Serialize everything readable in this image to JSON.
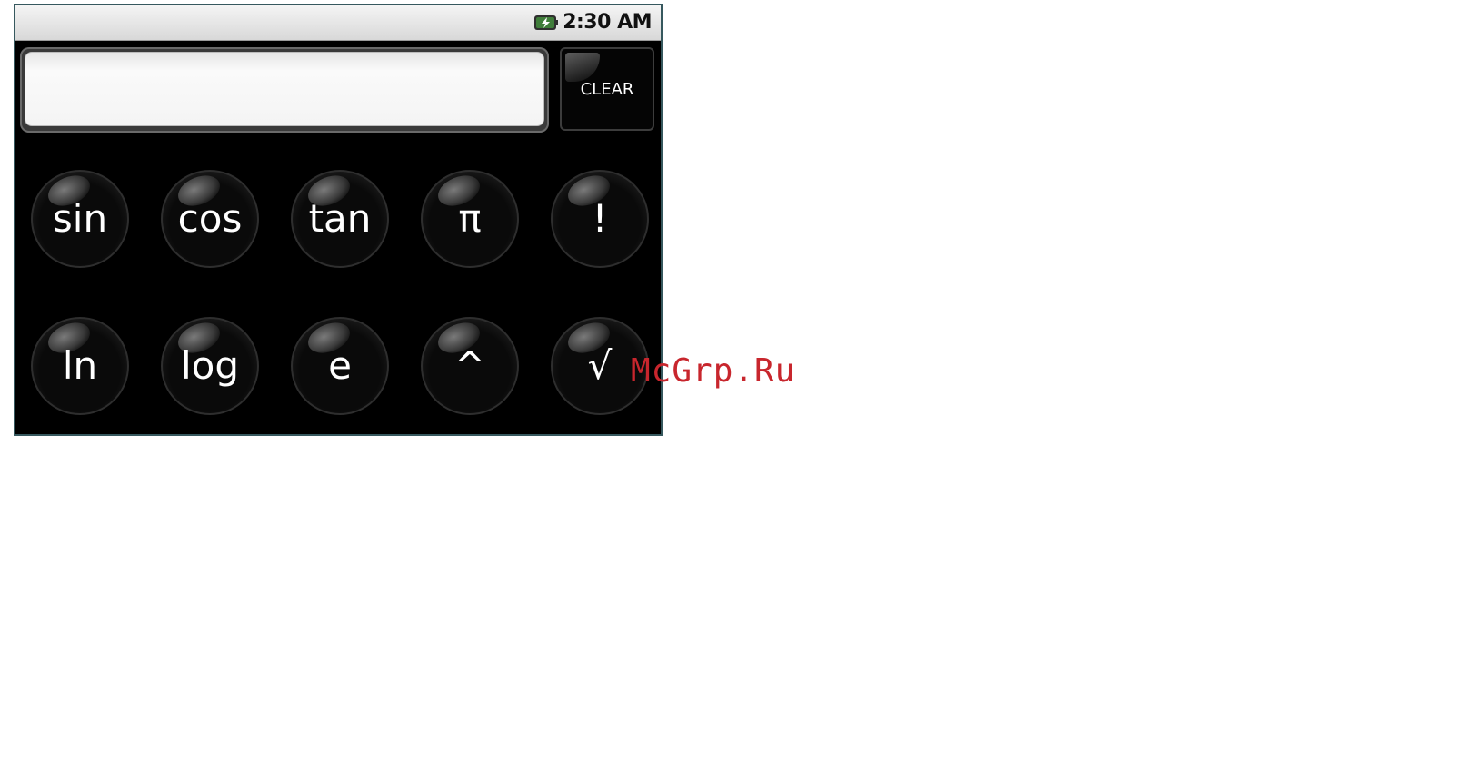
{
  "status_bar": {
    "time": "2:30 AM",
    "battery_icon": "battery-charging-icon"
  },
  "display": {
    "value": ""
  },
  "clear_button": {
    "label": "CLEAR"
  },
  "keys": [
    {
      "label": "sin"
    },
    {
      "label": "cos"
    },
    {
      "label": "tan"
    },
    {
      "label": "π"
    },
    {
      "label": "!"
    },
    {
      "label": "ln"
    },
    {
      "label": "log"
    },
    {
      "label": "e"
    },
    {
      "label": "^"
    },
    {
      "label": "√"
    }
  ],
  "watermark": {
    "text": "McGrp.Ru"
  },
  "colors": {
    "device_bg": "#000000",
    "device_border": "#36585e",
    "watermark": "#c8262d",
    "key_text": "#ffffff"
  }
}
